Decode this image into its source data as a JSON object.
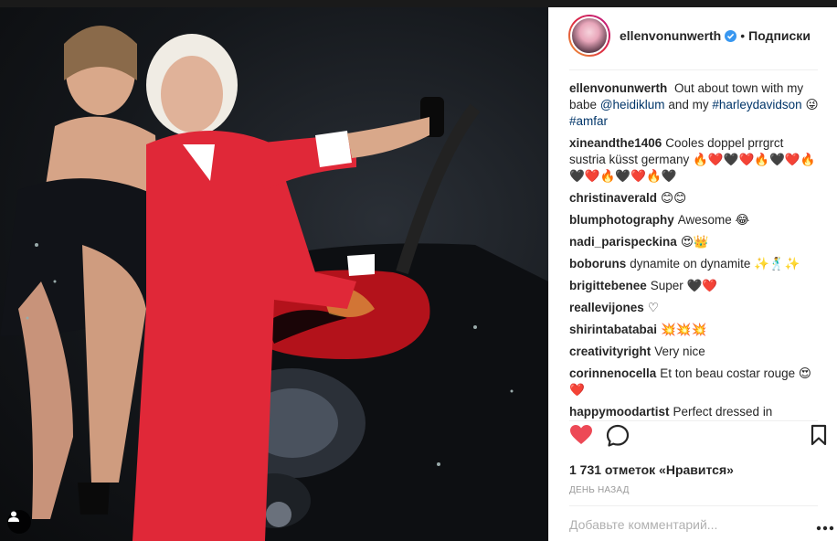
{
  "post": {
    "username": "ellenvonunwerth",
    "follow_label": "Подписки",
    "separator": "•",
    "caption": {
      "user": "ellenvonunwerth",
      "text_1": "Out about town with my babe",
      "mention": "@heidiklum",
      "text_2": "and my",
      "hashtag_1": "#harleydavidson",
      "emoji": "😜",
      "hashtag_2": "#amfar"
    },
    "comments": [
      {
        "user": "xineandthe1406",
        "text": "Cooles doppel prrgrct sustria küsst germany 🔥❤️🖤❤️🔥🖤❤️🔥🖤❤️🔥🖤❤️🔥🖤"
      },
      {
        "user": "christinaverald",
        "text": "😊😊"
      },
      {
        "user": "blumphotography",
        "text": "Awesome 😂"
      },
      {
        "user": "nadi_parispeckina",
        "text": "😍👑"
      },
      {
        "user": "boboruns",
        "text": "dynamite on dynamite ✨🕺✨"
      },
      {
        "user": "brigittebenee",
        "text": "Super 🖤❤️"
      },
      {
        "user": "reallevijones",
        "text": "♡"
      },
      {
        "user": "shirintabatabai",
        "text": "💥💥💥"
      },
      {
        "user": "creativityright",
        "text": "Very nice"
      },
      {
        "user": "corinnenocella",
        "text": "Et ton beau costar rouge 😍❤️"
      },
      {
        "user": "happymoodartist",
        "text": "Perfect dressed in"
      }
    ],
    "likes_label": "1 731 отметок «Нравится»",
    "time_label": "ДЕНЬ НАЗАД",
    "add_comment_placeholder": "Добавьте комментарий..."
  },
  "icons": {
    "like": "heart-icon",
    "comment": "comment-icon",
    "save": "bookmark-icon",
    "verified": "verified-badge-icon",
    "tagged": "person-tag-icon",
    "more": "more-options-icon"
  },
  "colors": {
    "like_red": "#ed4956",
    "verified_blue": "#3897f0",
    "link_blue": "#003569",
    "muted": "#999999"
  }
}
